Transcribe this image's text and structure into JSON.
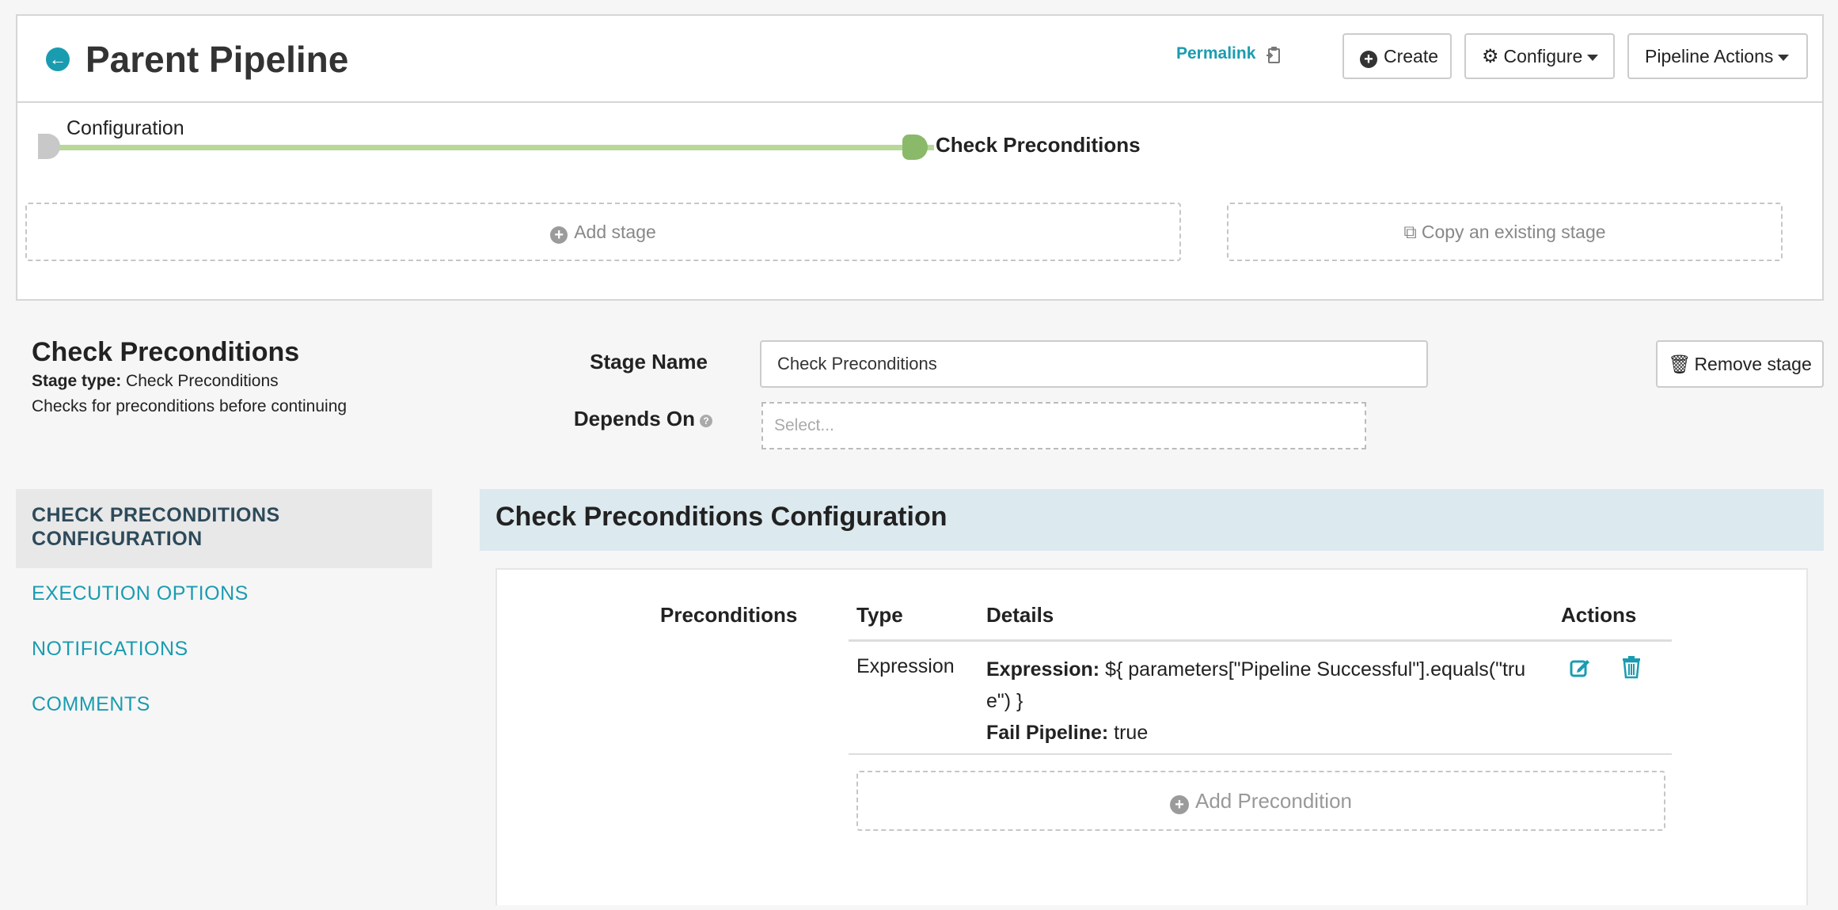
{
  "header": {
    "title": "Parent Pipeline",
    "permalink": "Permalink",
    "create_label": "Create",
    "configure_label": "Configure",
    "actions_label": "Pipeline Actions"
  },
  "graph": {
    "stages": [
      "Configuration",
      "Check Preconditions"
    ],
    "add_stage": "Add stage",
    "copy_stage": "Copy an existing stage"
  },
  "stage": {
    "heading": "Check Preconditions",
    "type_label": "Stage type:",
    "type_value": "Check Preconditions",
    "description": "Checks for preconditions before continuing",
    "name_label": "Stage Name",
    "name_value": "Check Preconditions",
    "depends_label": "Depends On",
    "depends_placeholder": "Select...",
    "remove_label": "Remove stage"
  },
  "nav": {
    "items": [
      "CHECK PRECONDITIONS CONFIGURATION",
      "EXECUTION OPTIONS",
      "NOTIFICATIONS",
      "COMMENTS"
    ],
    "active": "CHECK PRECONDITIONS CONFIGURATION"
  },
  "config": {
    "title": "Check Preconditions Configuration",
    "preconditions_label": "Preconditions",
    "columns": [
      "Type",
      "Details",
      "Actions"
    ],
    "rows": [
      {
        "type": "Expression",
        "expression_label": "Expression:",
        "expression_value": "${ parameters[\"Pipeline Successful\"].equals(\"true\") }",
        "fail_label": "Fail Pipeline:",
        "fail_value": "true"
      }
    ],
    "add_label": "Add Precondition"
  },
  "colors": {
    "accent": "#1a9cb0",
    "graph_line": "#b8d89a",
    "graph_node_active": "#8ab96a",
    "panel_header": "#dce9ee"
  }
}
